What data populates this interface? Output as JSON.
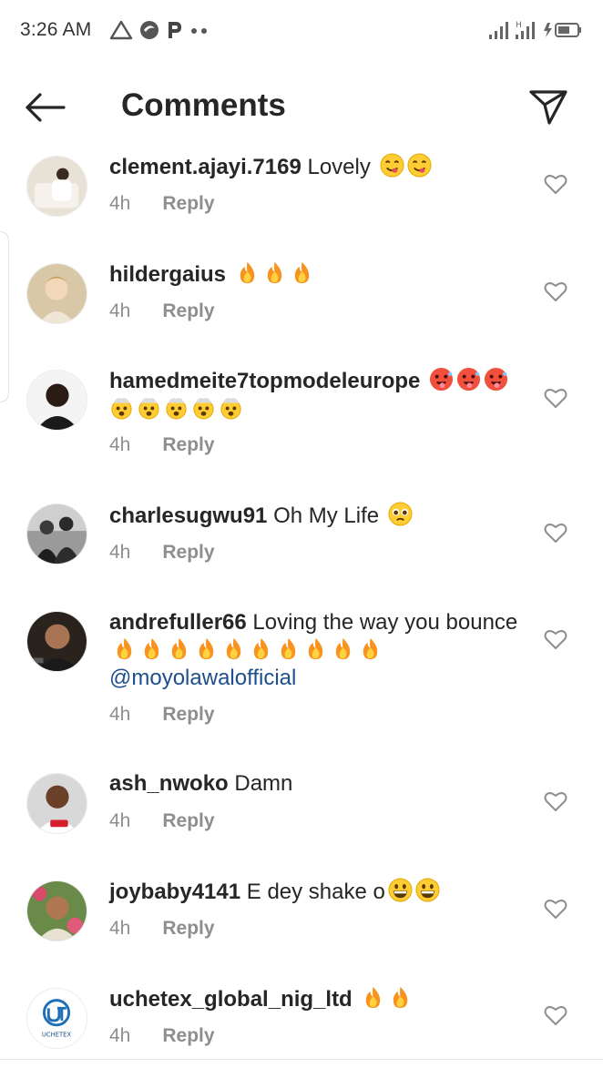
{
  "status_bar": {
    "time": "3:26 AM",
    "left_icons": [
      "alert-triangle-icon",
      "speed-logo-icon",
      "parking-p-icon",
      "more-dots-icon"
    ],
    "right_icons": [
      "signal-bars-icon",
      "signal-hd-icon",
      "battery-charging-icon"
    ]
  },
  "header": {
    "title": "Comments",
    "back_icon": "back-arrow-icon",
    "send_icon": "send-paper-plane-icon"
  },
  "reply_label": "Reply",
  "comments": [
    {
      "username": "clement.ajayi.7169",
      "text": "Lovely",
      "emojis": [
        "yum",
        "yum"
      ],
      "time": "4h",
      "avatar_color": "#e8e2d6"
    },
    {
      "username": "hildergaius",
      "text": "",
      "emojis": [
        "fire",
        "fire",
        "fire"
      ],
      "time": "4h",
      "avatar_color": "#d8c8a8"
    },
    {
      "username": "hamedmeite7topmodeleurope",
      "text": "",
      "emojis": [
        "hot",
        "hot",
        "hot",
        "exploding",
        "exploding",
        "exploding",
        "exploding",
        "exploding"
      ],
      "time": "4h",
      "avatar_color": "#f0f0f0"
    },
    {
      "username": "charlesugwu91",
      "text": "Oh My Life",
      "emojis": [
        "pleading"
      ],
      "time": "4h",
      "avatar_color": "#8a8a8a"
    },
    {
      "username": "andrefuller66",
      "text": "Loving the way you bounce",
      "emojis": [
        "fire",
        "fire",
        "fire",
        "fire",
        "fire",
        "fire",
        "fire",
        "fire",
        "fire",
        "fire"
      ],
      "mention": "@moyolawalofficial",
      "time": "4h",
      "avatar_color": "#3a3028"
    },
    {
      "username": "ash_nwoko",
      "text": "Damn",
      "emojis": [],
      "time": "4h",
      "avatar_color": "#5a3a2a"
    },
    {
      "username": "joybaby4141",
      "text": "E dey shake o",
      "emojis": [
        "grin",
        "grin"
      ],
      "time": "4h",
      "avatar_color": "#6a8a4a"
    },
    {
      "username": "uchetex_global_nig_ltd",
      "text": "",
      "emojis": [
        "fire",
        "fire"
      ],
      "time": "4h",
      "avatar_color": "#ffffff",
      "avatar_text": "UCHETEX"
    }
  ]
}
